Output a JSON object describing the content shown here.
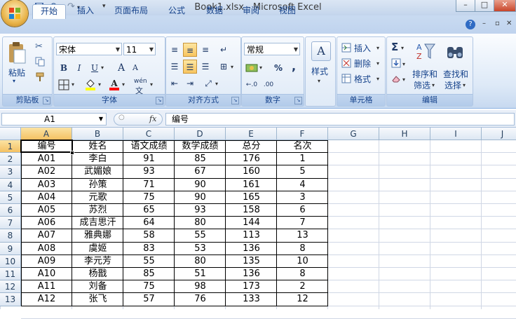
{
  "window": {
    "title": "Book1.xlsx - Microsoft Excel"
  },
  "tabs": [
    "开始",
    "插入",
    "页面布局",
    "公式",
    "数据",
    "审阅",
    "视图"
  ],
  "ribbon": {
    "clipboard": {
      "label": "剪贴板",
      "paste": "粘贴"
    },
    "font": {
      "label": "字体",
      "name": "宋体",
      "size": "11",
      "bold": "B",
      "italic": "I",
      "underline": "U",
      "grow": "A",
      "shrink": "A",
      "phonetic": "wén"
    },
    "alignment": {
      "label": "对齐方式"
    },
    "number": {
      "label": "数字",
      "format": "常规",
      "percent": "%",
      "comma": ","
    },
    "styles": {
      "label": "样式"
    },
    "cells": {
      "label": "单元格",
      "insert": "插入",
      "delete": "删除",
      "format": "格式"
    },
    "editing": {
      "label": "编辑",
      "sort": "排序和",
      "filter": "筛选",
      "find": "查找和",
      "select": "选择"
    }
  },
  "formula_bar": {
    "name_box": "A1",
    "fx": "fx",
    "content": "编号"
  },
  "columns": [
    "A",
    "B",
    "C",
    "D",
    "E",
    "F",
    "G",
    "H",
    "I",
    "J"
  ],
  "rows": [
    "1",
    "2",
    "3",
    "4",
    "5",
    "6",
    "7",
    "8",
    "9",
    "10",
    "11",
    "12",
    "13"
  ],
  "table": [
    [
      "编号",
      "姓名",
      "语文成绩",
      "数学成绩",
      "总分",
      "名次"
    ],
    [
      "A01",
      "李白",
      "91",
      "85",
      "176",
      "1"
    ],
    [
      "A02",
      "武媚娘",
      "93",
      "67",
      "160",
      "5"
    ],
    [
      "A03",
      "孙策",
      "71",
      "90",
      "161",
      "4"
    ],
    [
      "A04",
      "元歌",
      "75",
      "90",
      "165",
      "3"
    ],
    [
      "A05",
      "苏烈",
      "65",
      "93",
      "158",
      "6"
    ],
    [
      "A06",
      "成吉思汗",
      "64",
      "80",
      "144",
      "7"
    ],
    [
      "A07",
      "雅典娜",
      "58",
      "55",
      "113",
      "13"
    ],
    [
      "A08",
      "虞姬",
      "83",
      "53",
      "136",
      "8"
    ],
    [
      "A09",
      "李元芳",
      "55",
      "80",
      "135",
      "10"
    ],
    [
      "A10",
      "杨戬",
      "85",
      "51",
      "136",
      "8"
    ],
    [
      "A11",
      "刘备",
      "75",
      "98",
      "173",
      "2"
    ],
    [
      "A12",
      "张飞",
      "57",
      "76",
      "133",
      "12"
    ]
  ]
}
